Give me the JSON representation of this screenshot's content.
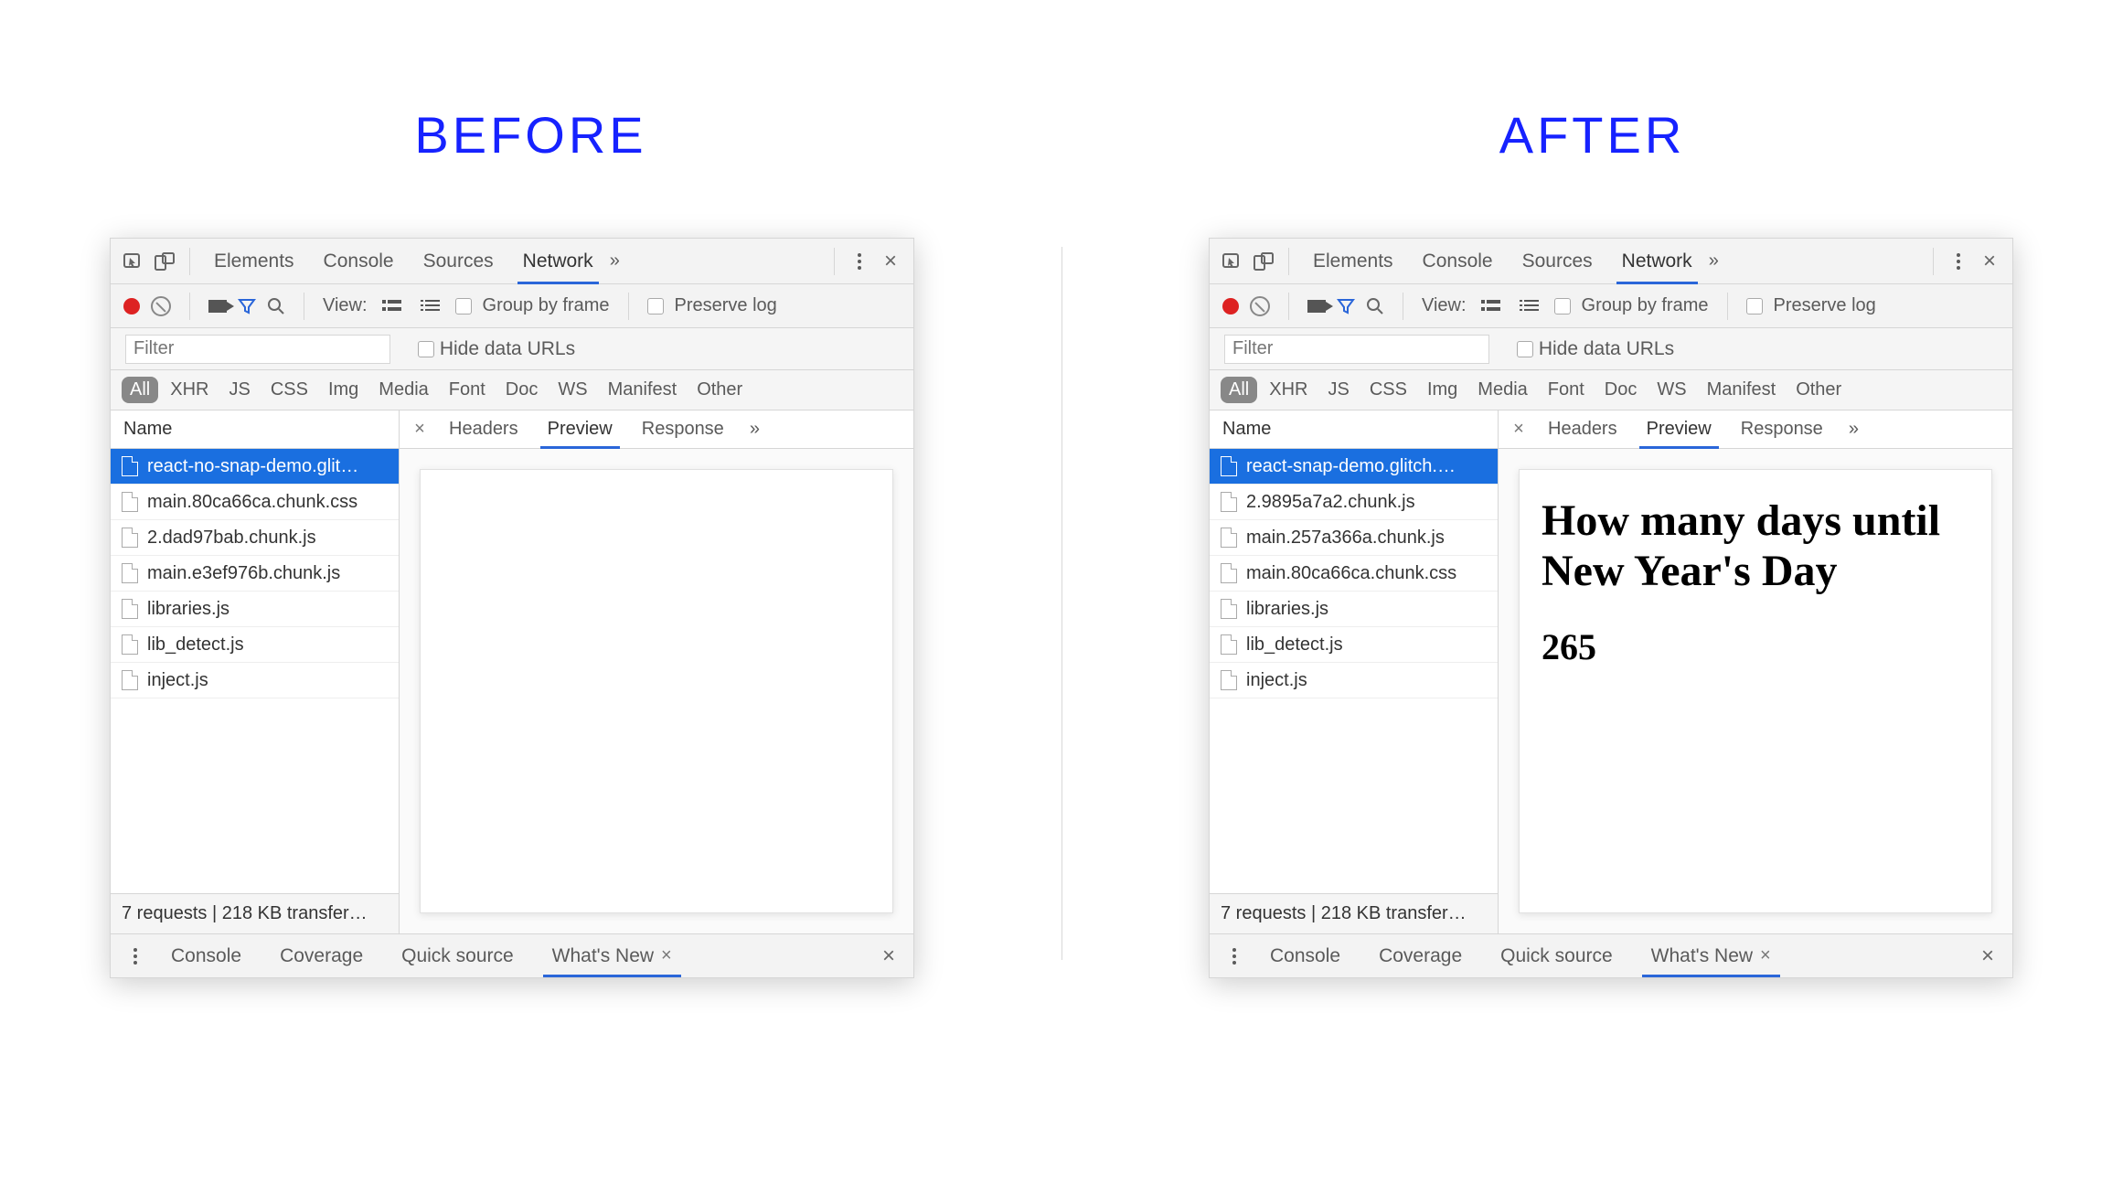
{
  "headings": {
    "before": "BEFORE",
    "after": "AFTER"
  },
  "top_tabs": [
    "Elements",
    "Console",
    "Sources",
    "Network"
  ],
  "top_tabs_active": "Network",
  "toolbar": {
    "view_label": "View:",
    "group_by_frame": "Group by frame",
    "preserve_log": "Preserve log"
  },
  "filter": {
    "placeholder": "Filter",
    "hide_data_urls": "Hide data URLs"
  },
  "type_filters": [
    "All",
    "XHR",
    "JS",
    "CSS",
    "Img",
    "Media",
    "Font",
    "Doc",
    "WS",
    "Manifest",
    "Other"
  ],
  "type_filter_active": "All",
  "name_header": "Name",
  "detail_tabs": [
    "Headers",
    "Preview",
    "Response"
  ],
  "detail_tabs_active": "Preview",
  "footer": "7 requests | 218 KB transfer…",
  "drawer_tabs": [
    "Console",
    "Coverage",
    "Quick source",
    "What's New"
  ],
  "drawer_tab_active": "What's New",
  "before": {
    "files": [
      "react-no-snap-demo.glit…",
      "main.80ca66ca.chunk.css",
      "2.dad97bab.chunk.js",
      "main.e3ef976b.chunk.js",
      "libraries.js",
      "lib_detect.js",
      "inject.js"
    ],
    "selected_index": 0,
    "preview": {
      "title": "",
      "value": ""
    }
  },
  "after": {
    "files": [
      "react-snap-demo.glitch.…",
      "2.9895a7a2.chunk.js",
      "main.257a366a.chunk.js",
      "main.80ca66ca.chunk.css",
      "libraries.js",
      "lib_detect.js",
      "inject.js"
    ],
    "selected_index": 0,
    "preview": {
      "title": "How many days until New Year's Day",
      "value": "265"
    }
  }
}
